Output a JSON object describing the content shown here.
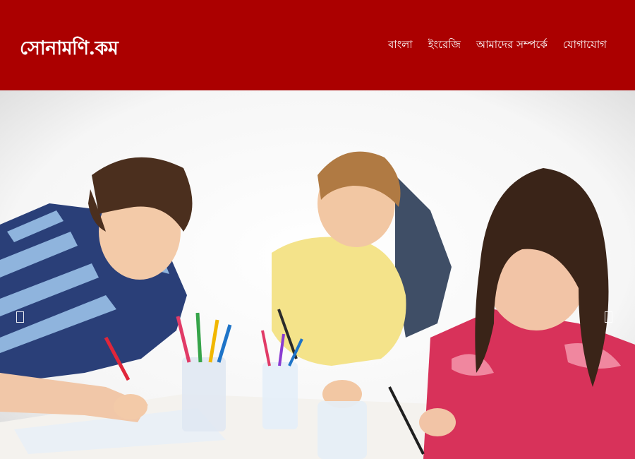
{
  "header": {
    "brand": "সোনামণি.কম",
    "nav": [
      {
        "label": "বাংলা"
      },
      {
        "label": "ইংরেজি"
      },
      {
        "label": "আমাদের সম্পর্কে"
      },
      {
        "label": "যোগাযোগ"
      }
    ]
  },
  "colors": {
    "header_bg": "#ab0000",
    "text": "#ffffff"
  },
  "carousel": {
    "slide_icon": "children-drawing-photo",
    "prev_icon": "chevron-left-icon",
    "next_icon": "chevron-right-icon"
  }
}
